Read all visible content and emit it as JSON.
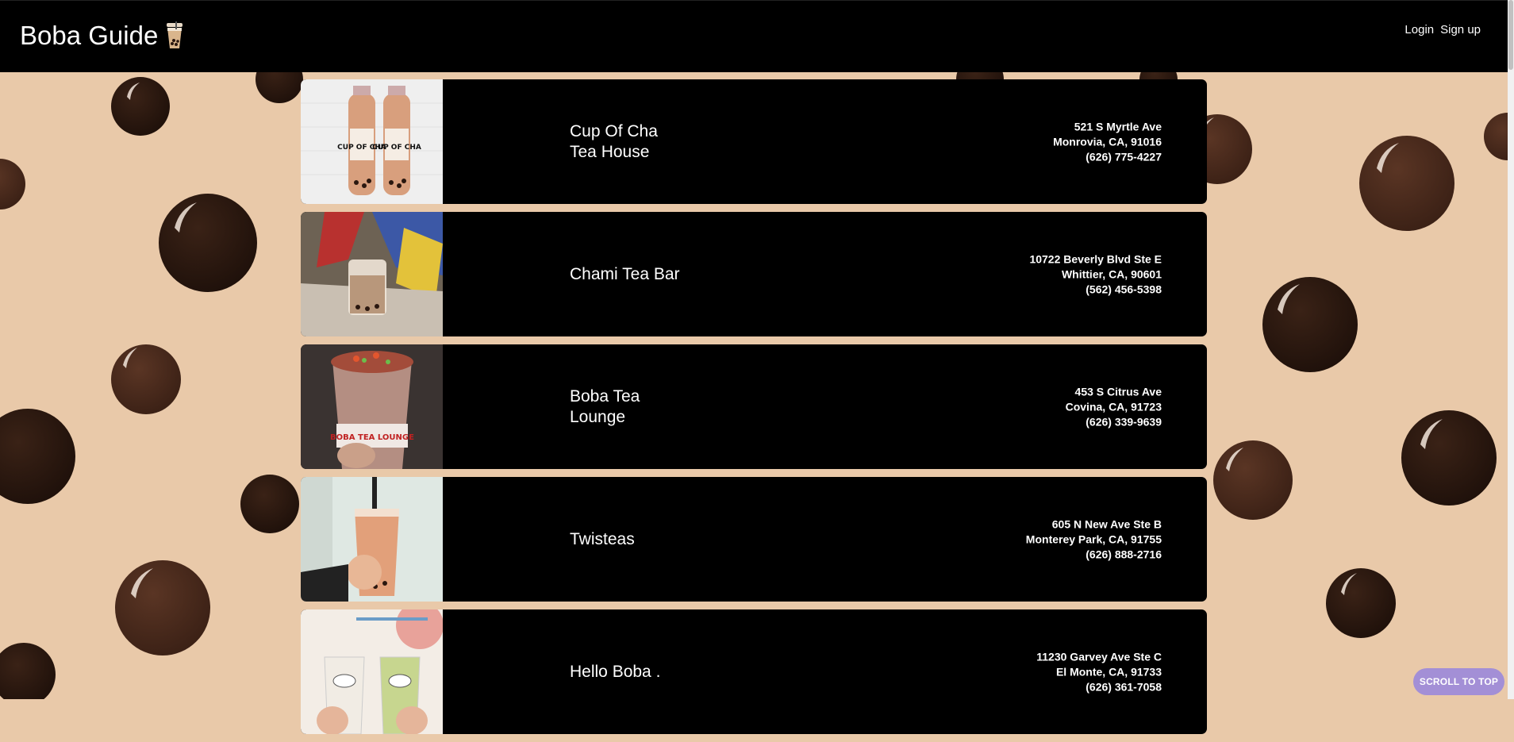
{
  "brand": {
    "title": "Boba Guide"
  },
  "nav": {
    "login": "Login",
    "signup": "Sign up"
  },
  "shops": [
    {
      "name": "Cup Of Cha Tea House",
      "street": "521 S Myrtle Ave",
      "city": "Monrovia, CA, 91016",
      "phone": "(626) 775-4227",
      "photo_text": "CUP OF CHA"
    },
    {
      "name": "Chami Tea Bar",
      "street": "10722 Beverly Blvd Ste E",
      "city": "Whittier, CA, 90601",
      "phone": "(562) 456-5398"
    },
    {
      "name": "Boba Tea Lounge",
      "street": "453 S Citrus Ave",
      "city": "Covina, CA, 91723",
      "phone": "(626) 339-9639",
      "photo_text": "BOBA TEA LOUNGE"
    },
    {
      "name": "Twisteas",
      "street": "605 N New Ave Ste B",
      "city": "Monterey Park, CA, 91755",
      "phone": "(626) 888-2716"
    },
    {
      "name": "Hello Boba .",
      "street": "11230 Garvey Ave Ste C",
      "city": "El Monte, CA, 91733",
      "phone": "(626) 361-7058"
    }
  ],
  "scroll_top": {
    "label": "SCROLL TO TOP"
  },
  "colors": {
    "background": "#e9c9a9",
    "pearl_dark": "#2a170f",
    "pearl_mid": "#4a2a1c",
    "navbar": "#000000",
    "card": "#000000",
    "button": "#a38fd6"
  }
}
